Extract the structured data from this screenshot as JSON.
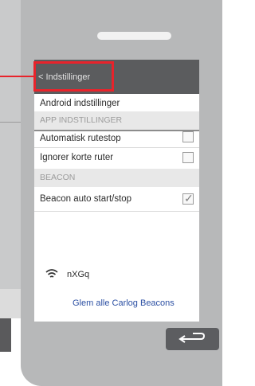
{
  "titlebar": {
    "back_label": "< Indstillinger"
  },
  "rows": {
    "android_settings": "Android indstillinger",
    "auto_route_stop": "Automatisk rutestop",
    "ignore_short_routes": "Ignorer korte ruter",
    "beacon_auto": "Beacon auto start/stop"
  },
  "sections": {
    "app_settings": "APP INDSTILLINGER",
    "beacon": "BEACON"
  },
  "checkboxes": {
    "auto_route_stop": false,
    "ignore_short_routes": false,
    "beacon_auto": true
  },
  "beacon": {
    "icon": "wifi-icon",
    "device_name": "nXGq",
    "forget_all": "Glem alle Carlog Beacons"
  },
  "hardware": {
    "back_icon": "return-arrow-icon"
  },
  "colors": {
    "titlebar": "#5b5c5e",
    "highlight": "#e8232b",
    "link": "#2b4fa3",
    "phone_body": "#b7b8b9"
  }
}
